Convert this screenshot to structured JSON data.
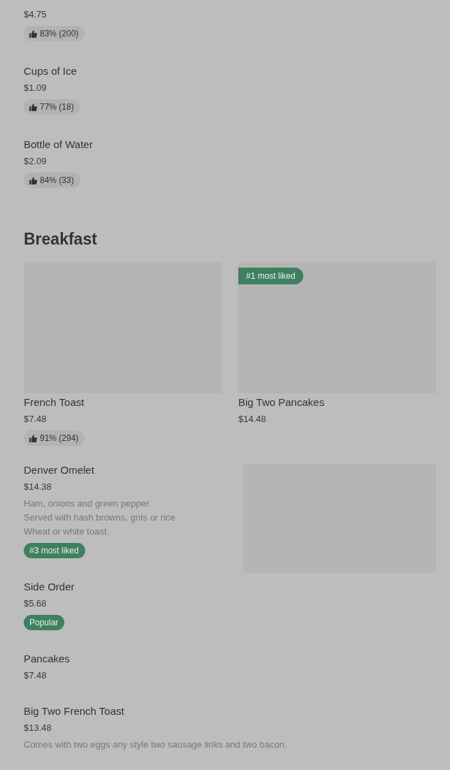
{
  "top_items": [
    {
      "price": "$4.75",
      "badges": [
        {
          "kind": "rating",
          "text": "83% (200)"
        }
      ]
    },
    {
      "name": "Cups of Ice",
      "price": "$1.09",
      "badges": [
        {
          "kind": "rating",
          "text": "77% (18)"
        }
      ]
    },
    {
      "name": "Bottle of Water",
      "price": "$2.09",
      "badges": [
        {
          "kind": "rating",
          "text": "84% (33)"
        }
      ]
    }
  ],
  "breakfast": {
    "title": "Breakfast",
    "featured": [
      {
        "name": "French Toast",
        "price": "$7.48",
        "badges": [
          {
            "kind": "rating",
            "text": "91% (294)"
          }
        ]
      },
      {
        "name": "Big Two Pancakes",
        "price": "$14.48",
        "image_badge": "#1 most liked"
      }
    ],
    "items": [
      {
        "name": "Denver Omelet",
        "price": "$14.38",
        "description_lines": [
          "Ham, onions and green pepper.",
          "Served with hash browns, grits or rice.",
          "Wheat or white toast."
        ],
        "badges": [
          {
            "kind": "highlight",
            "text": "#3 most liked"
          }
        ],
        "has_image": true
      },
      {
        "name": "Side Order",
        "price": "$5.68",
        "badges": [
          {
            "kind": "highlight",
            "text": "Popular"
          }
        ]
      },
      {
        "name": "Pancakes",
        "price": "$7.48"
      },
      {
        "name": "Big Two French Toast",
        "price": "$13.48",
        "description_lines": [
          "Comes with two eggs any style two sausage links and two bacon."
        ]
      }
    ]
  }
}
